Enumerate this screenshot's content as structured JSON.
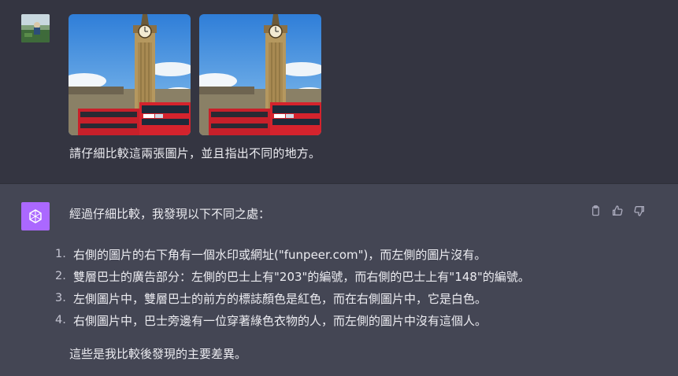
{
  "user": {
    "avatar": "user-avatar",
    "message": "請仔細比較這兩張圖片，並且指出不同的地方。"
  },
  "assistant": {
    "intro": "經過仔細比較，我發現以下不同之處：",
    "items": [
      {
        "num": "1.",
        "text": "右側的圖片的右下角有一個水印或網址(\"funpeer.com\")，而左側的圖片沒有。"
      },
      {
        "num": "2.",
        "text": "雙層巴士的廣告部分：左側的巴士上有\"203\"的編號，而右側的巴士上有\"148\"的編號。"
      },
      {
        "num": "3.",
        "text": "左側圖片中，雙層巴士的前方的標誌顏色是紅色，而在右側圖片中，它是白色。"
      },
      {
        "num": "4.",
        "text": "右側圖片中，巴士旁邊有一位穿著綠色衣物的人，而左側的圖片中沒有這個人。"
      }
    ],
    "conclusion": "這些是我比較後發現的主要差異。",
    "actions": [
      "clipboard-icon",
      "thumbs-up-icon",
      "thumbs-down-icon"
    ]
  },
  "colors": {
    "user_bg": "#343541",
    "assistant_bg": "#444654",
    "assistant_avatar": "#ab68ff"
  }
}
